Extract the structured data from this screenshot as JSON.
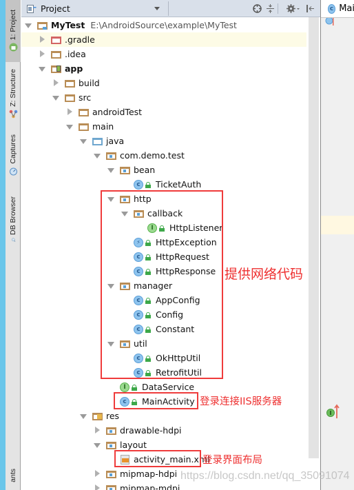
{
  "tool_strip": {
    "tabs": [
      {
        "label": "1: Project",
        "icon": "android-icon",
        "active": true
      },
      {
        "label": "Z: Structure",
        "icon": "structure-icon",
        "active": false
      },
      {
        "label": "Captures",
        "icon": "captures-icon",
        "active": false
      },
      {
        "label": "DB Browser",
        "icon": "db-browser-icon",
        "active": false
      },
      {
        "label": "ants",
        "icon": "",
        "active": false
      }
    ]
  },
  "panel": {
    "view_selector": "Project",
    "header_buttons": [
      "scroll-from-source-icon",
      "collapse-all-icon",
      "settings-icon",
      "hide-panel-icon"
    ]
  },
  "tree": [
    {
      "name": "MyTest",
      "path": "E:\\AndroidSource\\example\\MyTest",
      "type": "project",
      "depth": 0,
      "expanded": true,
      "bold": true
    },
    {
      "name": ".gradle",
      "type": "folder-excluded",
      "depth": 1,
      "expanded": false
    },
    {
      "name": ".idea",
      "type": "folder",
      "depth": 1,
      "expanded": false
    },
    {
      "name": "app",
      "type": "module",
      "depth": 1,
      "expanded": true,
      "bold": true
    },
    {
      "name": "build",
      "type": "folder",
      "depth": 2,
      "expanded": false
    },
    {
      "name": "src",
      "type": "folder",
      "depth": 2,
      "expanded": true
    },
    {
      "name": "androidTest",
      "type": "folder",
      "depth": 3,
      "expanded": false
    },
    {
      "name": "main",
      "type": "folder",
      "depth": 3,
      "expanded": true
    },
    {
      "name": "java",
      "type": "source-root",
      "depth": 4,
      "expanded": true
    },
    {
      "name": "com.demo.test",
      "type": "package",
      "depth": 5,
      "expanded": true
    },
    {
      "name": "bean",
      "type": "package",
      "depth": 6,
      "expanded": true
    },
    {
      "name": "TicketAuth",
      "type": "class",
      "depth": 7
    },
    {
      "name": "http",
      "type": "package",
      "depth": 6,
      "expanded": true
    },
    {
      "name": "callback",
      "type": "package",
      "depth": 7,
      "expanded": true
    },
    {
      "name": "HttpListener",
      "type": "interface",
      "depth": 8
    },
    {
      "name": "HttpException",
      "type": "exception",
      "depth": 7
    },
    {
      "name": "HttpRequest",
      "type": "class",
      "depth": 7
    },
    {
      "name": "HttpResponse",
      "type": "class",
      "depth": 7
    },
    {
      "name": "manager",
      "type": "package",
      "depth": 6,
      "expanded": true
    },
    {
      "name": "AppConfig",
      "type": "class",
      "depth": 7
    },
    {
      "name": "Config",
      "type": "class",
      "depth": 7
    },
    {
      "name": "Constant",
      "type": "class",
      "depth": 7
    },
    {
      "name": "util",
      "type": "package",
      "depth": 6,
      "expanded": true
    },
    {
      "name": "OkHttpUtil",
      "type": "class",
      "depth": 7
    },
    {
      "name": "RetrofitUtil",
      "type": "class",
      "depth": 7
    },
    {
      "name": "DataService",
      "type": "interface",
      "depth": 6
    },
    {
      "name": "MainActivity",
      "type": "class",
      "depth": 6
    },
    {
      "name": "res",
      "type": "resources",
      "depth": 4,
      "expanded": true
    },
    {
      "name": "drawable-hdpi",
      "type": "package",
      "depth": 5,
      "expanded": false
    },
    {
      "name": "layout",
      "type": "package",
      "depth": 5,
      "expanded": true
    },
    {
      "name": "activity_main.xml",
      "type": "xml",
      "depth": 6
    },
    {
      "name": "mipmap-hdpi",
      "type": "package",
      "depth": 5,
      "expanded": false
    },
    {
      "name": "mipmap-mdpi",
      "type": "package",
      "depth": 5,
      "expanded": false
    }
  ],
  "annotations": {
    "network_code": "提供网络代码",
    "main_activity": "登录连接IIS服务器",
    "layout": "登录界面布局"
  },
  "editor": {
    "tab_label": "Mai",
    "tab_icon": "class-icon"
  },
  "watermark": "https://blog.csdn.net/qq_35091074",
  "colors": {
    "accent": "#6ac6ea",
    "annotation_red": "#ef3b3b",
    "highlight_row": "#fdfbe6",
    "folder": "#b98d56",
    "class_icon": "#8ec4ee",
    "interface_icon": "#9ad98f"
  }
}
